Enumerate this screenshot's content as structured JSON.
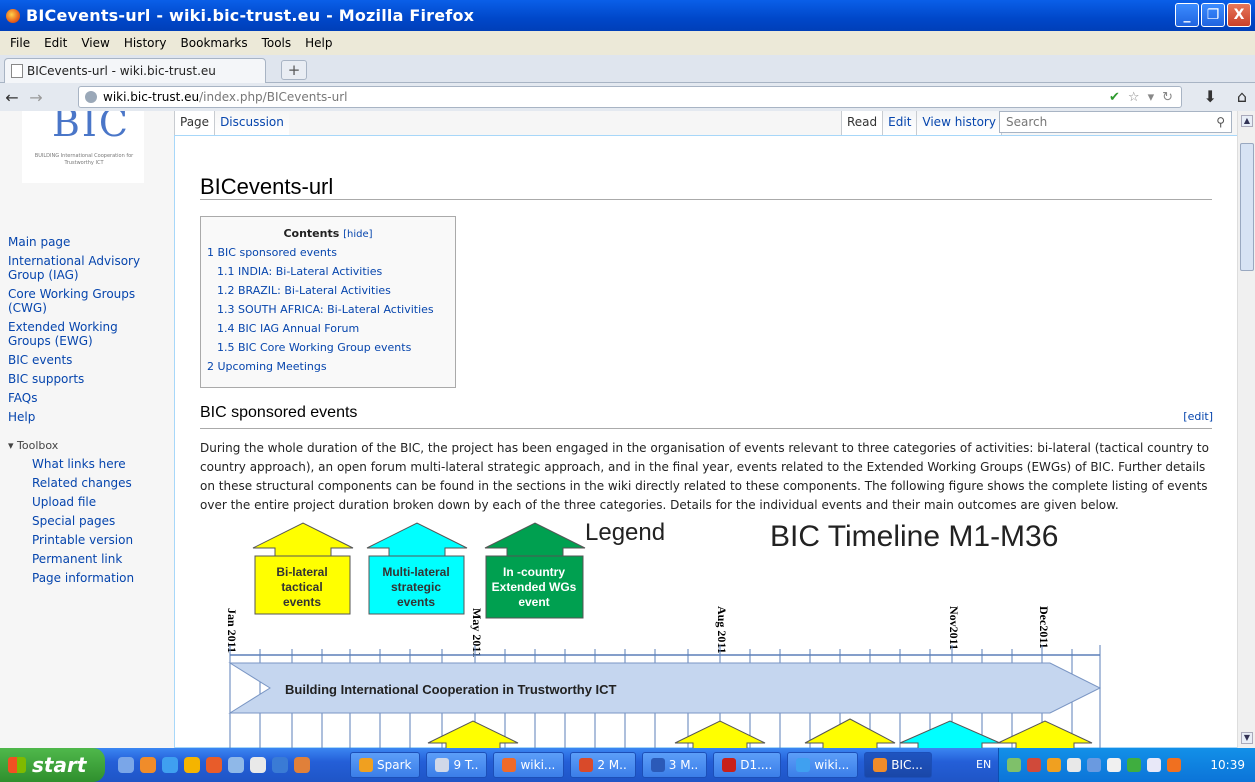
{
  "window": {
    "title": "BICevents-url - wiki.bic-trust.eu - Mozilla Firefox",
    "minimize": "_",
    "maximize": "❐",
    "close": "X"
  },
  "menu": [
    "File",
    "Edit",
    "View",
    "History",
    "Bookmarks",
    "Tools",
    "Help"
  ],
  "tab": {
    "title": "BICevents-url - wiki.bic-trust.eu",
    "newtab": "+"
  },
  "url": {
    "host": "wiki.bic-trust.eu",
    "path": "/index.php/BICevents-url"
  },
  "logo": {
    "text": "BIC",
    "tagline": "BUILDING International Cooperation for Trustworthy ICT"
  },
  "sidebar": {
    "items": [
      "Main page",
      "International Advisory Group (IAG)",
      "Core Working Groups (CWG)",
      "Extended Working Groups (EWG)",
      "BIC events",
      "BIC supports",
      "FAQs",
      "Help"
    ],
    "toolbox_heading": "Toolbox",
    "toolbox": [
      "What links here",
      "Related changes",
      "Upload file",
      "Special pages",
      "Printable version",
      "Permanent link",
      "Page information"
    ]
  },
  "wiki_tabs": {
    "page": "Page",
    "discussion": "Discussion",
    "read": "Read",
    "edit": "Edit",
    "history": "View history",
    "search_placeholder": "Search"
  },
  "page": {
    "title": "BICevents-url",
    "toc_title": "Contents",
    "toc_hide": "[hide]",
    "toc": [
      {
        "label": "1 BIC sponsored events",
        "sub": false
      },
      {
        "label": "1.1 INDIA: Bi-Lateral Activities",
        "sub": true
      },
      {
        "label": "1.2 BRAZIL: Bi-Lateral Activities",
        "sub": true
      },
      {
        "label": "1.3 SOUTH AFRICA: Bi-Lateral Activities",
        "sub": true
      },
      {
        "label": "1.4 BIC IAG Annual Forum",
        "sub": true
      },
      {
        "label": "1.5 BIC Core Working Group events",
        "sub": true
      },
      {
        "label": "2 Upcoming Meetings",
        "sub": false
      }
    ],
    "section_title": "BIC sponsored events",
    "edit_link": "[edit]",
    "paragraph": "During the whole duration of the BIC, the project has been engaged in the organisation of events relevant to three categories of activities: bi-lateral (tactical country to country approach), an open forum multi-lateral strategic approach, and in the final year, events related to the Extended Working Groups (EWGs) of BIC. Further details on these structural components can be found in the sections in the wiki directly related to these components. The following figure shows the complete listing of events over the entire project duration broken down by each of the three categories. Details for the individual events and their main outcomes are given below."
  },
  "figure": {
    "title": "BIC Timeline M1-M36",
    "legend_label": "Legend",
    "legend": [
      {
        "label": "Bi-lateral tactical events",
        "color": "#ffff00"
      },
      {
        "label": "Multi-lateral strategic events",
        "color": "#00ffff"
      },
      {
        "label": "In-country Extended WGs event",
        "color": "#00a050"
      }
    ],
    "dates": [
      "Jan 2011",
      "May 2011",
      "Aug 2011",
      "Nov2011",
      "Dec2011"
    ],
    "banner": "Building International Cooperation in Trustworthy ICT"
  },
  "taskbar": {
    "start": "start",
    "items": [
      {
        "label": "Spark",
        "active": false
      },
      {
        "label": "9 T..",
        "active": false
      },
      {
        "label": "wiki...",
        "active": false
      },
      {
        "label": "2 M..",
        "active": false
      },
      {
        "label": "3 M..",
        "active": false
      },
      {
        "label": "D1....",
        "active": false
      },
      {
        "label": "wiki...",
        "active": false
      },
      {
        "label": "BIC...",
        "active": true
      }
    ],
    "lang": "EN",
    "clock": "10:39"
  },
  "colors": {
    "link": "#0645ad",
    "yellow": "#ffff00",
    "cyan": "#00ffff",
    "green": "#00a050",
    "banner": "#c5d6ef"
  }
}
